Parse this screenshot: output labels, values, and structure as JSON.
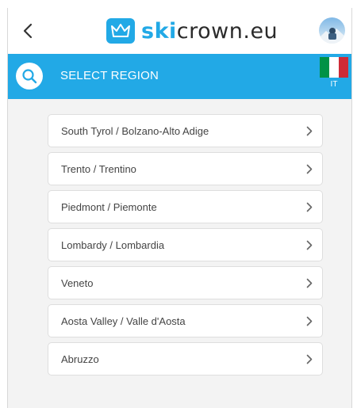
{
  "app": {
    "logo_prefix": "ski",
    "logo_suffix": "crown.eu",
    "logo_icon": "crown-icon",
    "back_icon": "chevron-left-icon",
    "avatar": "user-avatar"
  },
  "region_bar": {
    "title": "SELECT REGION",
    "search_icon": "search-icon",
    "country_code": "IT",
    "flag": "italy-flag"
  },
  "regions": [
    {
      "label": "South Tyrol / Bolzano-Alto Adige"
    },
    {
      "label": "Trento / Trentino"
    },
    {
      "label": "Piedmont / Piemonte"
    },
    {
      "label": "Lombardy / Lombardia"
    },
    {
      "label": "Veneto"
    },
    {
      "label": "Aosta Valley / Valle d'Aosta"
    },
    {
      "label": "Abruzzo"
    }
  ],
  "colors": {
    "accent": "#22a9e6",
    "flag_green": "#009246",
    "flag_white": "#ffffff",
    "flag_red": "#ce2b37"
  }
}
